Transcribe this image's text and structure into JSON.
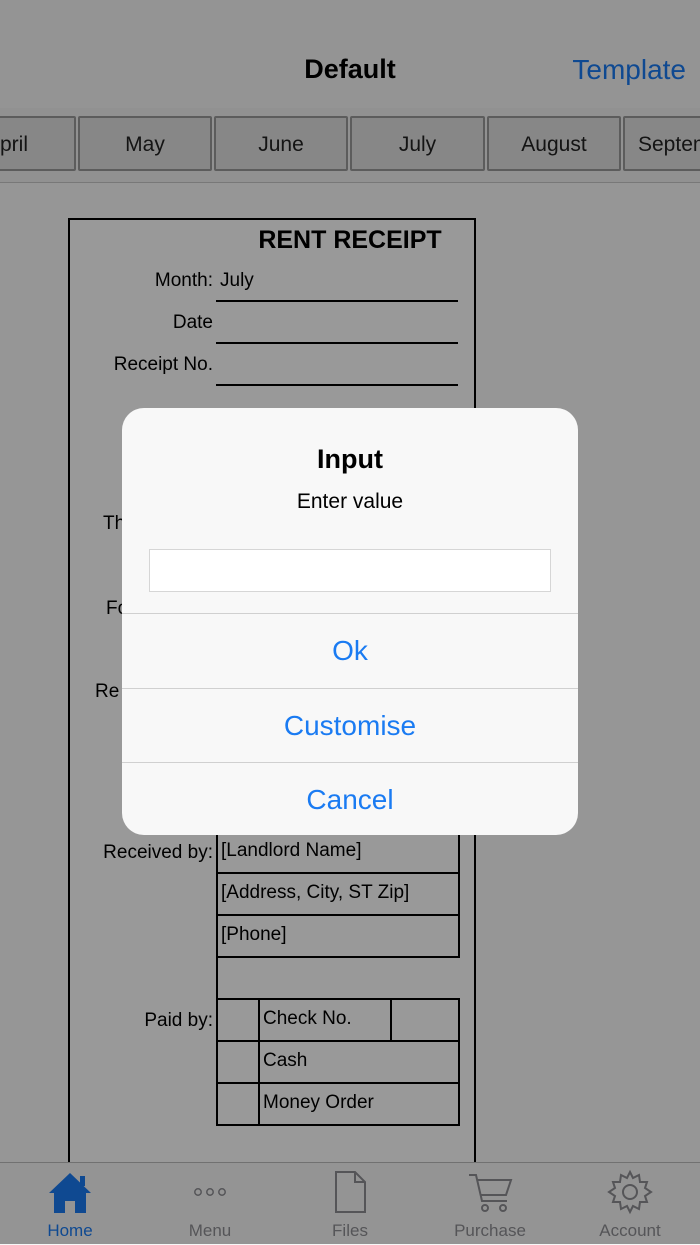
{
  "header": {
    "title": "Default",
    "template_label": "Template"
  },
  "months": [
    "April",
    "May",
    "June",
    "July",
    "August",
    "September"
  ],
  "receipt": {
    "title": "RENT RECEIPT",
    "month_label": "Month:",
    "month_value": "July",
    "date_label": "Date",
    "receipt_no_label": "Receipt No.",
    "partial_label_1": "Th",
    "partial_label_2": "Fo",
    "partial_label_3": "Re",
    "received_by_label": "Received by:",
    "landlord_name": "[Landlord Name]",
    "address": "[Address, City, ST  Zip]",
    "phone": "[Phone]",
    "paid_by_label": "Paid by:",
    "check_no": "Check No.",
    "cash": "Cash",
    "money_order": "Money Order"
  },
  "dialog": {
    "title": "Input",
    "message": "Enter value",
    "input_value": "",
    "ok": "Ok",
    "customise": "Customise",
    "cancel": "Cancel"
  },
  "tabs": [
    {
      "label": "Home",
      "icon": "home-icon",
      "active": true
    },
    {
      "label": "Menu",
      "icon": "more-dots-icon",
      "active": false
    },
    {
      "label": "Files",
      "icon": "file-icon",
      "active": false
    },
    {
      "label": "Purchase",
      "icon": "cart-icon",
      "active": false
    },
    {
      "label": "Account",
      "icon": "gear-icon",
      "active": false
    }
  ],
  "colors": {
    "accent": "#1a7bf2",
    "inactive": "#8e8e93"
  }
}
